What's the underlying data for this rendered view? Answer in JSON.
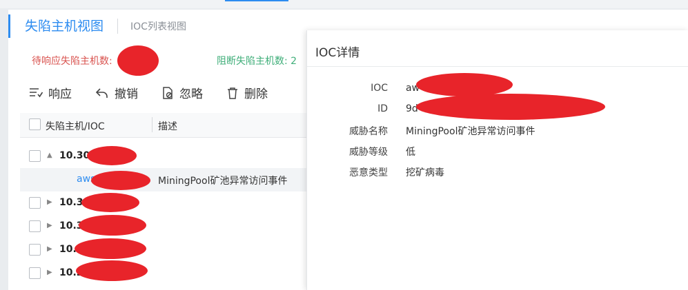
{
  "view_tabs": {
    "active": "失陷主机视图",
    "other": "IOC列表视图"
  },
  "stats": {
    "pending_label": "待响应失陷主机数:",
    "blocked_label": "阻断失陷主机数:",
    "blocked_value": "2"
  },
  "toolbar": {
    "respond": "响应",
    "revoke": "撤销",
    "ignore": "忽略",
    "delete": "删除"
  },
  "table": {
    "col_host": "失陷主机/IOC",
    "col_desc": "描述",
    "rows": [
      {
        "ip": "10.30",
        "expanded": true
      },
      {
        "ioc": "aws",
        "desc": "MiningPool矿池异常访问事件"
      },
      {
        "ip": "10.30",
        "expanded": false
      },
      {
        "ip": "10.3",
        "expanded": false
      },
      {
        "ip": "10.",
        "expanded": false
      },
      {
        "ip": "10.2",
        "expanded": false
      }
    ]
  },
  "detail": {
    "title": "IOC详情",
    "fields": [
      {
        "label": "IOC",
        "value": "aw"
      },
      {
        "label": "ID",
        "value": "9d"
      },
      {
        "label": "威胁名称",
        "value": "MiningPool矿池异常访问事件"
      },
      {
        "label": "威胁等级",
        "value": "低"
      },
      {
        "label": "恶意类型",
        "value": "挖矿病毒"
      }
    ]
  },
  "colors": {
    "accent": "#2d8cf0",
    "pending": "#d9534f",
    "blocked": "#3fae79",
    "redaction": "#e8242a"
  }
}
